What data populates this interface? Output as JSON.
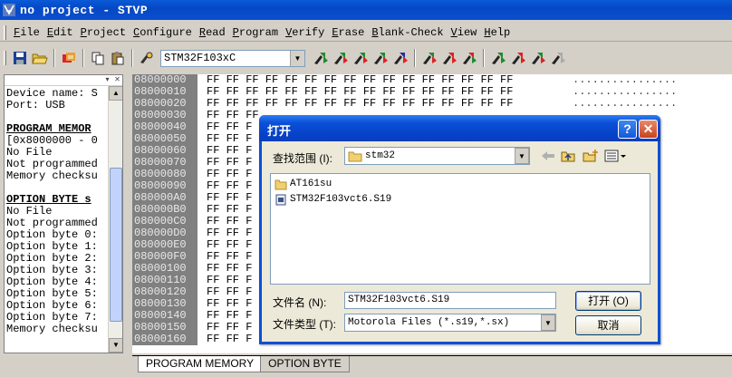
{
  "window": {
    "title": "no project - STVP"
  },
  "menu": [
    "File",
    "Edit",
    "Project",
    "Configure",
    "Read",
    "Program",
    "Verify",
    "Erase",
    "Blank-Check",
    "View",
    "Help"
  ],
  "toolbar": {
    "device": "STM32F103xC"
  },
  "left_panel": {
    "lines": [
      {
        "text": "Device name: S",
        "style": "normal"
      },
      {
        "text": "Port: USB",
        "style": "normal"
      },
      {
        "text": "",
        "style": "gap"
      },
      {
        "text": "PROGRAM MEMOR",
        "style": "heading"
      },
      {
        "text": "[0x8000000 - 0",
        "style": "normal"
      },
      {
        "text": "No File",
        "style": "normal"
      },
      {
        "text": "Not programmed",
        "style": "normal"
      },
      {
        "text": "Memory checksu",
        "style": "normal"
      },
      {
        "text": "",
        "style": "gap"
      },
      {
        "text": "OPTION BYTE s",
        "style": "heading"
      },
      {
        "text": "No File",
        "style": "normal"
      },
      {
        "text": "Not programmed",
        "style": "normal"
      },
      {
        "text": "Option byte 0:",
        "style": "normal"
      },
      {
        "text": "Option byte 1:",
        "style": "normal"
      },
      {
        "text": "Option byte 2:",
        "style": "normal"
      },
      {
        "text": "Option byte 3:",
        "style": "normal"
      },
      {
        "text": "Option byte 4:",
        "style": "normal"
      },
      {
        "text": "Option byte 5:",
        "style": "normal"
      },
      {
        "text": "Option byte 6:",
        "style": "normal"
      },
      {
        "text": "Option byte 7:",
        "style": "normal"
      },
      {
        "text": "Memory checksu",
        "style": "normal"
      }
    ]
  },
  "memory": {
    "rows": [
      {
        "addr": "08000000",
        "bytes": "FF FF FF FF FF FF FF FF FF FF FF FF FF FF FF FF",
        "ascii": "................"
      },
      {
        "addr": "08000010",
        "bytes": "FF FF FF FF FF FF FF FF FF FF FF FF FF FF FF FF",
        "ascii": "................"
      },
      {
        "addr": "08000020",
        "bytes": "FF FF FF FF FF FF FF FF FF FF FF FF FF FF FF FF",
        "ascii": "................"
      },
      {
        "addr": "08000030",
        "bytes": "FF FF FF",
        "ascii": ""
      },
      {
        "addr": "08000040",
        "bytes": "FF FF F",
        "ascii": ""
      },
      {
        "addr": "08000050",
        "bytes": "FF FF F",
        "ascii": ""
      },
      {
        "addr": "08000060",
        "bytes": "FF FF F",
        "ascii": ""
      },
      {
        "addr": "08000070",
        "bytes": "FF FF F",
        "ascii": ""
      },
      {
        "addr": "08000080",
        "bytes": "FF FF F",
        "ascii": ""
      },
      {
        "addr": "08000090",
        "bytes": "FF FF F",
        "ascii": ""
      },
      {
        "addr": "080000A0",
        "bytes": "FF FF F",
        "ascii": ""
      },
      {
        "addr": "080000B0",
        "bytes": "FF FF F",
        "ascii": ""
      },
      {
        "addr": "080000C0",
        "bytes": "FF FF F",
        "ascii": ""
      },
      {
        "addr": "080000D0",
        "bytes": "FF FF F",
        "ascii": ""
      },
      {
        "addr": "080000E0",
        "bytes": "FF FF F",
        "ascii": ""
      },
      {
        "addr": "080000F0",
        "bytes": "FF FF F",
        "ascii": ""
      },
      {
        "addr": "08000100",
        "bytes": "FF FF F",
        "ascii": ""
      },
      {
        "addr": "08000110",
        "bytes": "FF FF F",
        "ascii": ""
      },
      {
        "addr": "08000120",
        "bytes": "FF FF F",
        "ascii": ""
      },
      {
        "addr": "08000130",
        "bytes": "FF FF F",
        "ascii": ""
      },
      {
        "addr": "08000140",
        "bytes": "FF FF F",
        "ascii": ""
      },
      {
        "addr": "08000150",
        "bytes": "FF FF F",
        "ascii": ""
      },
      {
        "addr": "08000160",
        "bytes": "FF FF F",
        "ascii": ""
      }
    ]
  },
  "tabs": {
    "program": "PROGRAM MEMORY",
    "option": "OPTION BYTE"
  },
  "dialog": {
    "title": "打开",
    "help": "?",
    "close": "✕",
    "lookin_label": "查找范围 (I):",
    "lookin_value": "stm32",
    "files": [
      {
        "name": "AT161su",
        "icon": "folder-icon"
      },
      {
        "name": "STM32F103vct6.S19",
        "icon": "file-icon"
      }
    ],
    "filename_label": "文件名 (N):",
    "filename_value": "STM32F103vct6.S19",
    "filetype_label": "文件类型 (T):",
    "filetype_value": "Motorola Files (*.s19,*.sx)",
    "open_button": "打开 (O)",
    "cancel_button": "取消"
  }
}
